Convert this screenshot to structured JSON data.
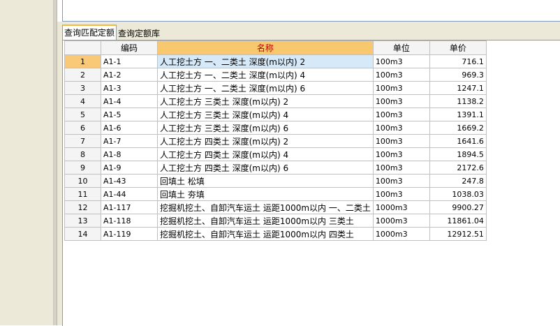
{
  "tabs": [
    {
      "label": "查询匹配定额",
      "active": true
    },
    {
      "label": "查询定额库",
      "active": false
    }
  ],
  "grid": {
    "headers": {
      "code": "编码",
      "name": "名称",
      "unit": "单位",
      "price": "单价"
    },
    "rows": [
      {
        "num": "1",
        "code": "A1-1",
        "name": "人工挖土方 一、二类土 深度(m以内) 2",
        "unit": "100m3",
        "price": "716.1"
      },
      {
        "num": "2",
        "code": "A1-2",
        "name": "人工挖土方 一、二类土 深度(m以内) 4",
        "unit": "100m3",
        "price": "969.3"
      },
      {
        "num": "3",
        "code": "A1-3",
        "name": "人工挖土方 一、二类土 深度(m以内) 6",
        "unit": "100m3",
        "price": "1247.1"
      },
      {
        "num": "4",
        "code": "A1-4",
        "name": "人工挖土方 三类土 深度(m以内) 2",
        "unit": "100m3",
        "price": "1138.2"
      },
      {
        "num": "5",
        "code": "A1-5",
        "name": "人工挖土方 三类土 深度(m以内) 4",
        "unit": "100m3",
        "price": "1391.1"
      },
      {
        "num": "6",
        "code": "A1-6",
        "name": "人工挖土方 三类土 深度(m以内) 6",
        "unit": "100m3",
        "price": "1669.2"
      },
      {
        "num": "7",
        "code": "A1-7",
        "name": "人工挖土方 四类土 深度(m以内) 2",
        "unit": "100m3",
        "price": "1641.6"
      },
      {
        "num": "8",
        "code": "A1-8",
        "name": "人工挖土方 四类土 深度(m以内) 4",
        "unit": "100m3",
        "price": "1894.5"
      },
      {
        "num": "9",
        "code": "A1-9",
        "name": "人工挖土方 四类土 深度(m以内) 6",
        "unit": "100m3",
        "price": "2172.6"
      },
      {
        "num": "10",
        "code": "A1-43",
        "name": "回填土 松填",
        "unit": "100m3",
        "price": "247.8"
      },
      {
        "num": "11",
        "code": "A1-44",
        "name": "回填土 夯填",
        "unit": "100m3",
        "price": "1038.03"
      },
      {
        "num": "12",
        "code": "A1-117",
        "name": "挖掘机挖土、自卸汽车运土 运距1000m以内 一、二类土",
        "unit": "1000m3",
        "price": "9900.27"
      },
      {
        "num": "13",
        "code": "A1-118",
        "name": "挖掘机挖土、自卸汽车运土 运距1000m以内 三类土",
        "unit": "1000m3",
        "price": "11861.04"
      },
      {
        "num": "14",
        "code": "A1-119",
        "name": "挖掘机挖土、自卸汽车运土 运距1000m以内 四类土",
        "unit": "1000m3",
        "price": "12912.51"
      }
    ]
  }
}
